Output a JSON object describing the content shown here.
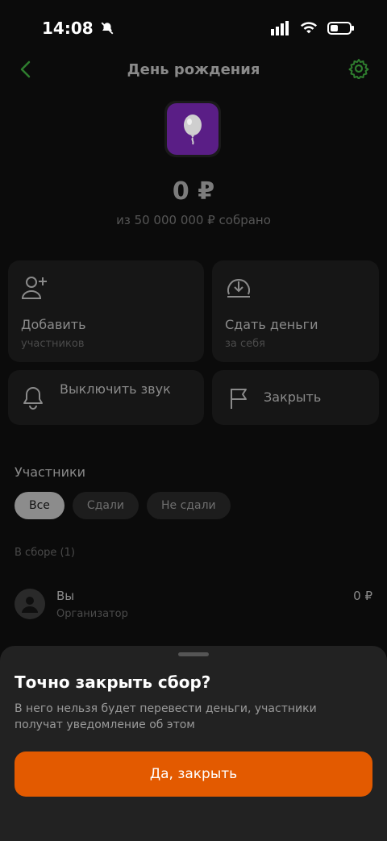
{
  "status_bar": {
    "time": "14:08"
  },
  "header": {
    "title": "День рождения"
  },
  "collection": {
    "amount": "0 ₽",
    "goal_text": "из 50 000 000 ₽ собрано"
  },
  "actions": [
    {
      "title": "Добавить",
      "subtitle": "участников"
    },
    {
      "title": "Сдать деньги",
      "subtitle": "за себя"
    },
    {
      "title": "Выключить звук"
    },
    {
      "title": "Закрыть"
    }
  ],
  "participants": {
    "title": "Участники",
    "filters": [
      "Все",
      "Сдали",
      "Не сдали"
    ],
    "group_label": "В сборе (1)",
    "members": [
      {
        "name": "Вы",
        "role": "Организатор",
        "amount": "0 ₽"
      }
    ]
  },
  "sheet": {
    "title": "Точно закрыть сбор?",
    "description": "В него нельзя будет перевести деньги, участники получат уведомление об этом",
    "confirm_label": "Да, закрыть"
  },
  "colors": {
    "accent_green": "#2e8b2e",
    "confirm_orange": "#e35a00",
    "sheet_bg": "#222222",
    "avatar_purple": "#5a1e86"
  }
}
